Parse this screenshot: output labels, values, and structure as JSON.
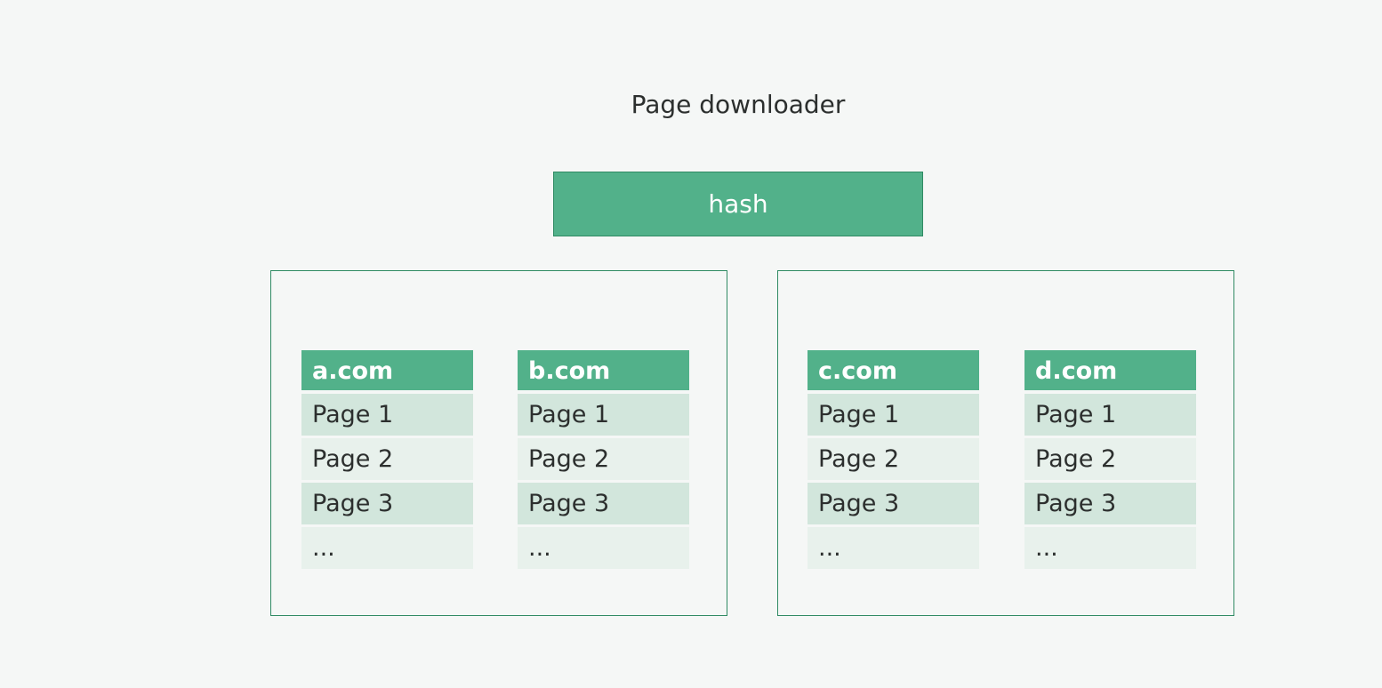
{
  "title": "Page downloader",
  "hash_label": "hash",
  "colors": {
    "background": "#f5f7f6",
    "accent": "#52b18a",
    "border": "#2f8a63",
    "row_dark": "#d2e6dc",
    "row_light": "#e8f1ec"
  },
  "groups": [
    {
      "queues": [
        {
          "host": "a.com",
          "items": [
            "Page 1",
            "Page 2",
            "Page 3",
            "..."
          ]
        },
        {
          "host": "b.com",
          "items": [
            "Page 1",
            "Page 2",
            "Page 3",
            "..."
          ]
        }
      ]
    },
    {
      "queues": [
        {
          "host": "c.com",
          "items": [
            "Page 1",
            "Page 2",
            "Page 3",
            "..."
          ]
        },
        {
          "host": "d.com",
          "items": [
            "Page 1",
            "Page 2",
            "Page 3",
            "..."
          ]
        }
      ]
    }
  ]
}
